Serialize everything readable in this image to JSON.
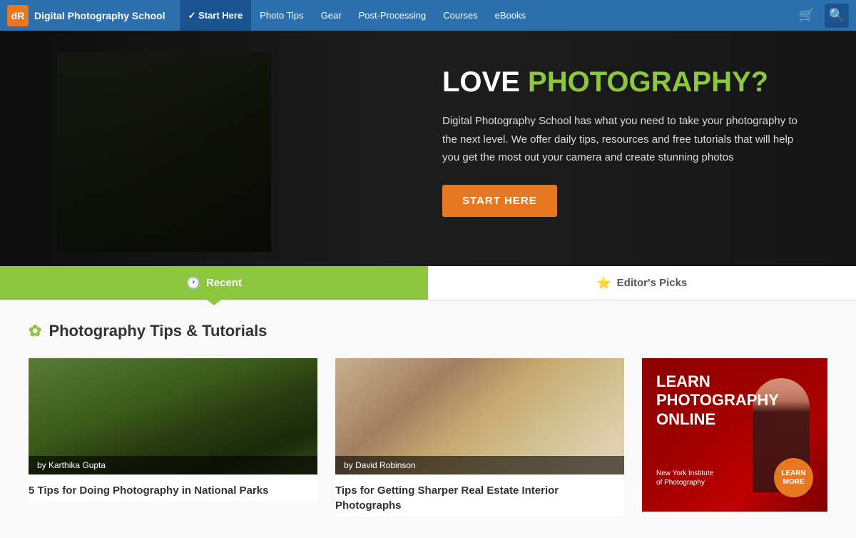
{
  "navbar": {
    "logo_initials": "dR",
    "logo_alt": "dPS logo",
    "site_name": "Digital Photography School",
    "nav_items": [
      {
        "id": "start-here",
        "label": "✓ Start Here",
        "active": true
      },
      {
        "id": "photo-tips",
        "label": "Photo Tips",
        "active": false
      },
      {
        "id": "gear",
        "label": "Gear",
        "active": false
      },
      {
        "id": "post-processing",
        "label": "Post-Processing",
        "active": false
      },
      {
        "id": "courses",
        "label": "Courses",
        "active": false
      },
      {
        "id": "ebooks",
        "label": "eBooks",
        "active": false
      }
    ],
    "cart_icon": "🛒",
    "search_icon": "🔍"
  },
  "hero": {
    "title_static": "LOVE",
    "title_highlight": "PHOTOGRAPHY?",
    "description": "Digital Photography School has what you need to take your photography to the next level. We offer daily tips, resources and free tutorials that will help you get the most out your camera and create stunning photos",
    "cta_label": "START HERE"
  },
  "tabs": [
    {
      "id": "recent",
      "label": "Recent",
      "icon": "🕐",
      "active": true
    },
    {
      "id": "editors-picks",
      "label": "Editor's Picks",
      "icon": "⭐",
      "active": false
    }
  ],
  "section": {
    "icon": "✿",
    "title": "Photography Tips & Tutorials"
  },
  "articles": [
    {
      "id": "article-1",
      "author": "by Karthika Gupta",
      "title": "5 Tips for Doing Photography in National Parks",
      "img_type": "hiking"
    },
    {
      "id": "article-2",
      "author": "by David Robinson",
      "title": "Tips for Getting Sharper Real Estate Interior Photographs",
      "img_type": "interior"
    }
  ],
  "ad": {
    "headline": "LEARN\nPHOTOGRAPHY\nONLINE",
    "cta_label": "LEARN\nMORE",
    "logo_line1": "New York Institute",
    "logo_line2": "of Photography"
  },
  "colors": {
    "brand_blue": "#2c6fad",
    "brand_orange": "#e87722",
    "brand_green": "#8dc63f",
    "dark_blue": "#1a5490",
    "ad_red": "#8b0000"
  }
}
